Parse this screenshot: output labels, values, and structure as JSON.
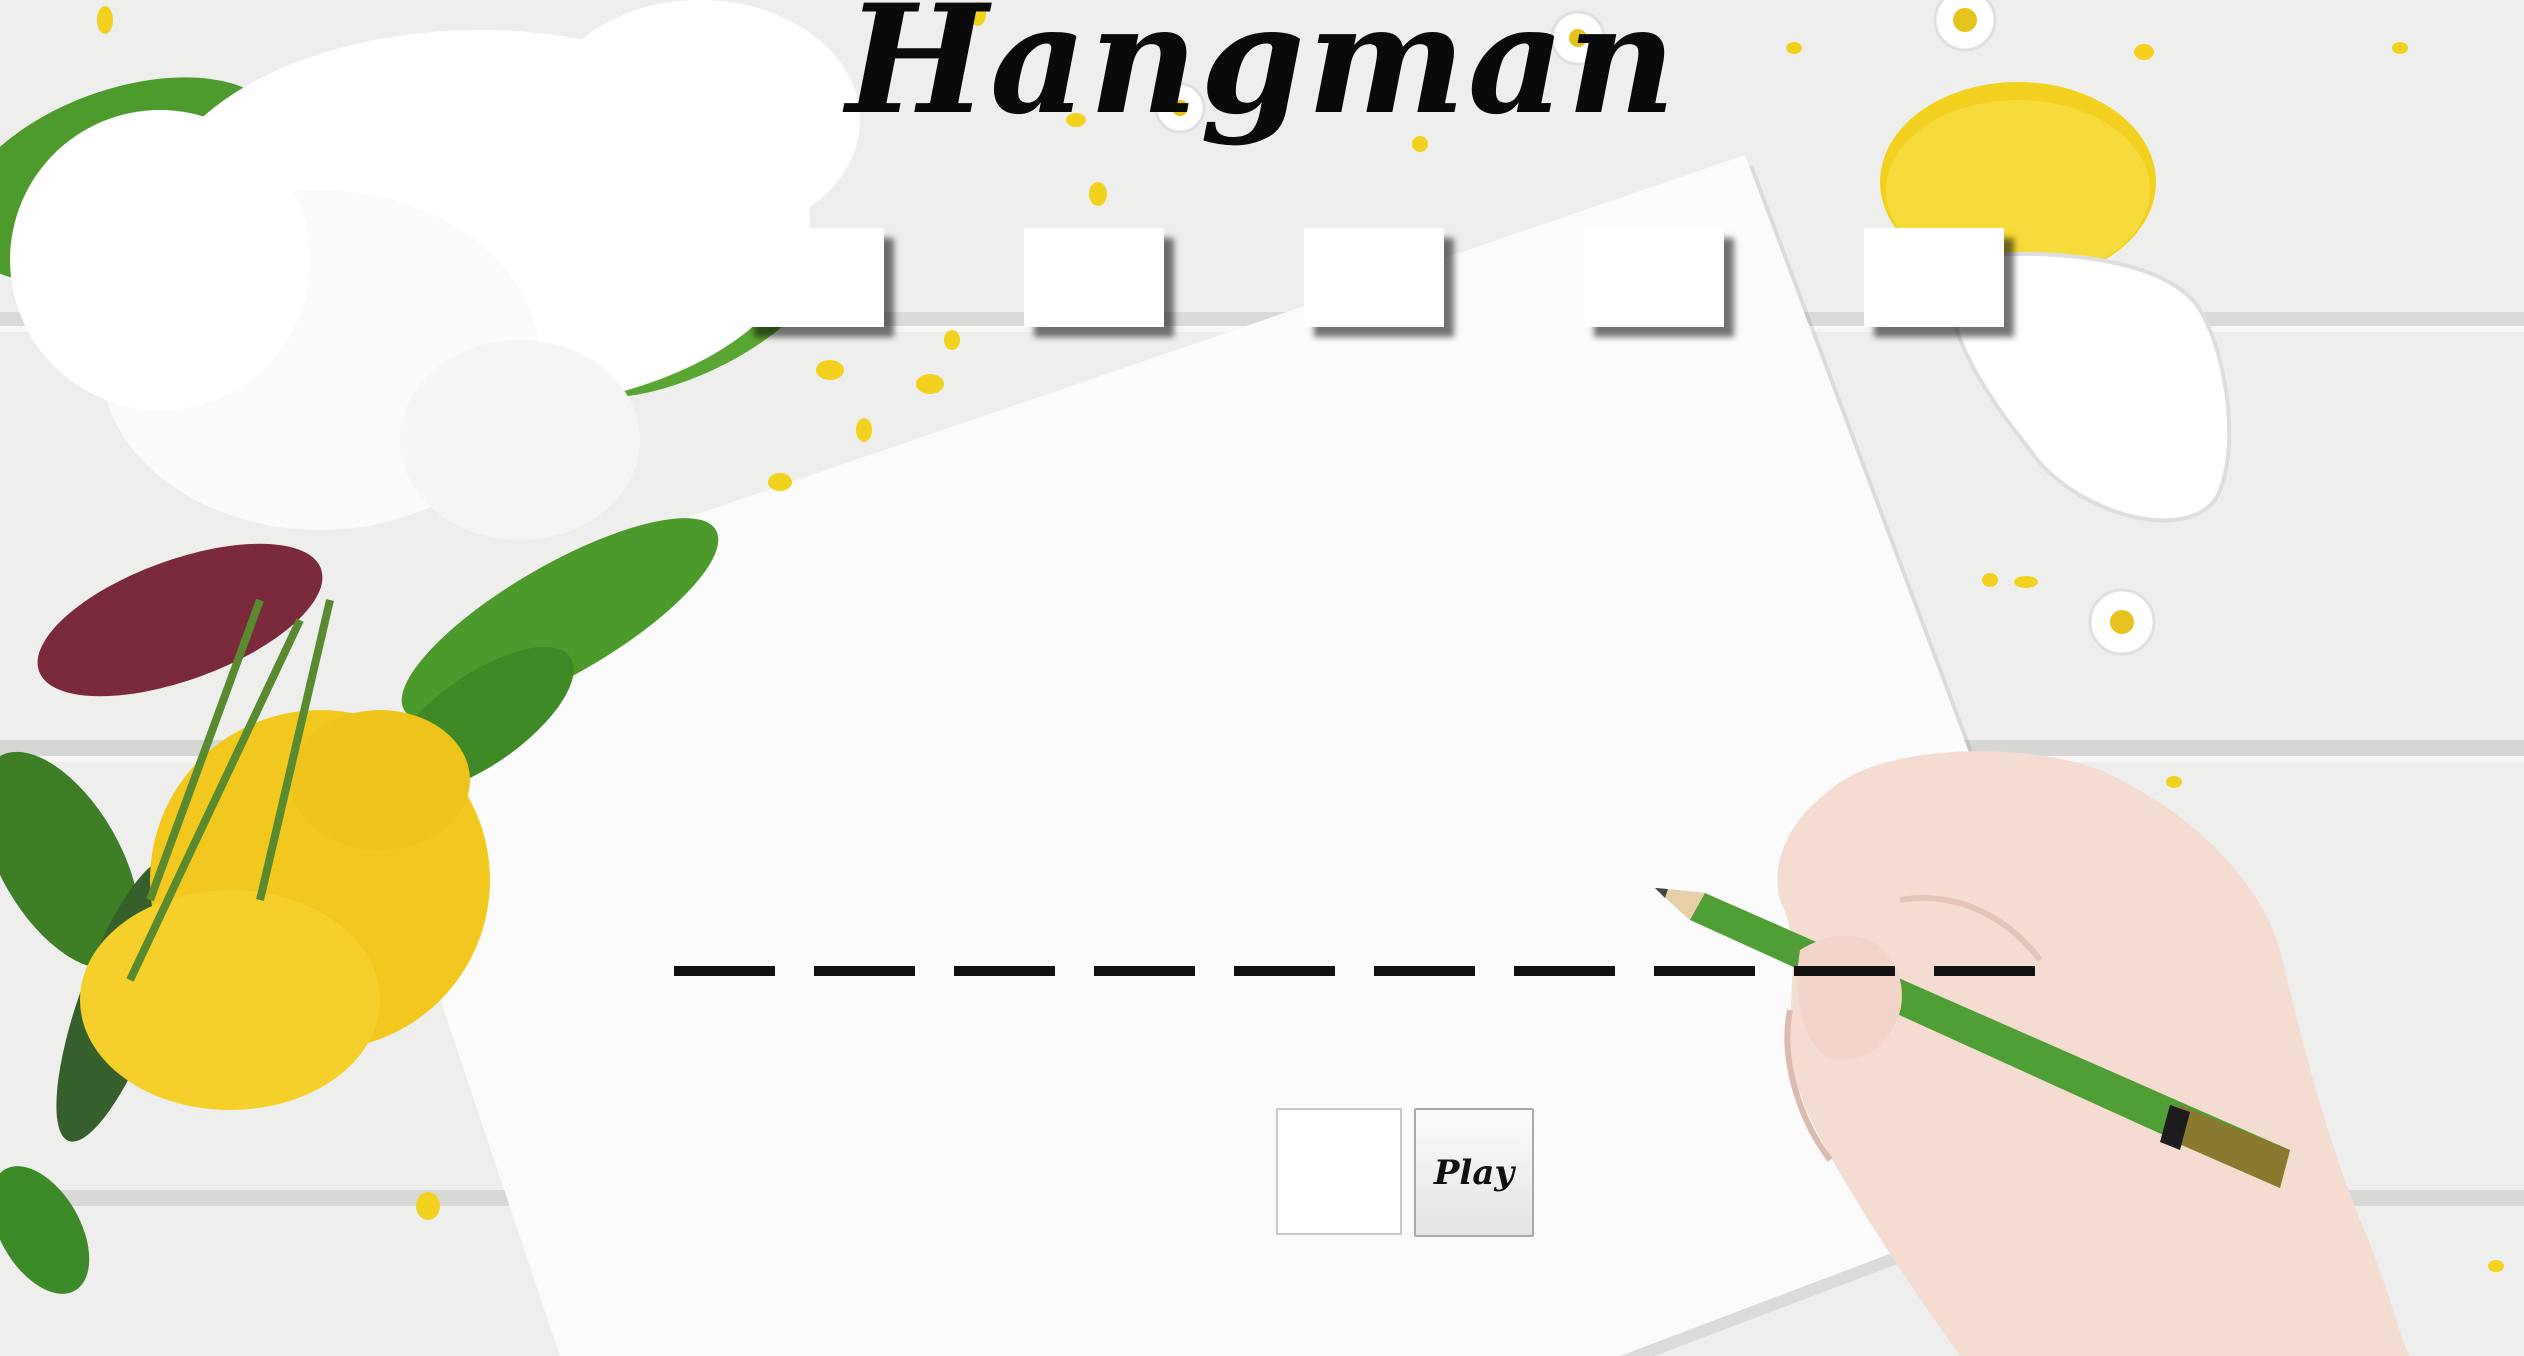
{
  "game": {
    "title": "Hangman",
    "wrong_guess_slots": 5,
    "word_length": 10,
    "input": {
      "value": "",
      "placeholder": ""
    },
    "play_label": "Play"
  },
  "colors": {
    "background": "#ecedeb",
    "ink": "#111111",
    "leaf_green": "#4d9a2c",
    "flower_yellow": "#f2c81f",
    "pencil_green": "#4f9e36"
  },
  "icons": {
    "flowers": "flower-bouquet-illustration",
    "pencil": "pencil-icon",
    "hand": "hand-illustration"
  }
}
